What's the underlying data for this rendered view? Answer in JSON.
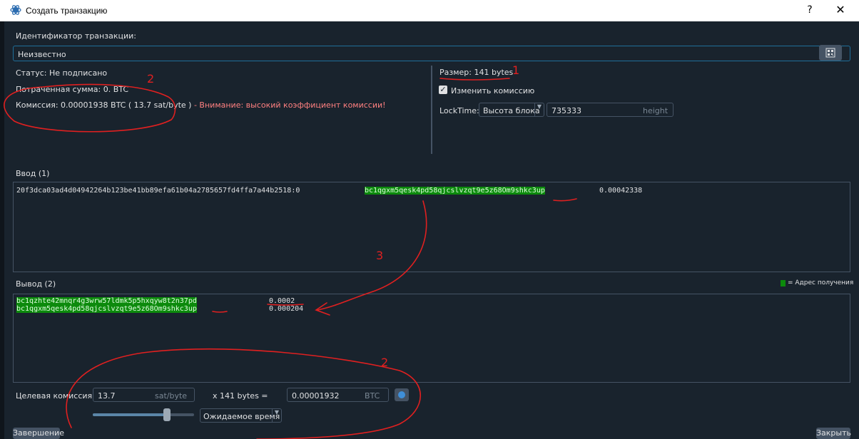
{
  "window": {
    "title": "Создать транзакцию",
    "help": "?",
    "close": "✕"
  },
  "txid": {
    "label": "Идентификатор транзакции:",
    "value": "Неизвестно"
  },
  "status": {
    "status_text": "Статус: Не подписано",
    "spent_text": "Потраченная сумма: 0. BTC",
    "fee_text": "Комиссия: 0.00001938 BTC ( 13.7 sat/byte )",
    "fee_warning": " - Внимание: высокий коэффициент комиссии!"
  },
  "right": {
    "size_text": "Размер: 141 bytes",
    "change_fee_label": "Изменить комиссию",
    "change_fee_checked": true,
    "locktime_label": "LockTime:",
    "locktime_mode": "Высота блока",
    "locktime_value": "735333",
    "locktime_unit": "height"
  },
  "inputs": {
    "label": "Ввод (1)",
    "rows": [
      {
        "txref": "20f3dca03ad4d04942264b123be41bb89efa61b04a2785657fd4ffa7a44b2518:0",
        "address": "bc1qgxm5qesk4pd58qjcslvzqt9e5z68Om9shkc3up",
        "amount": "0.00042338"
      }
    ]
  },
  "outputs": {
    "label": "Вывод (2)",
    "legend": "= Адрес получения",
    "rows": [
      {
        "address": "bc1qzhte42mnqr4g3wrw57ldmk5p5hxqyw8t2n37pd",
        "amount": "0.0002"
      },
      {
        "address": "bc1qgxm5qesk4pd58qjcslvzqt9e5z68Om9shkc3up",
        "amount": "0.000204"
      }
    ]
  },
  "fee_target": {
    "label": "Целевая комиссия:",
    "rate_value": "13.7",
    "rate_unit": "sat/byte",
    "times_size": "x  141 bytes  =",
    "fee_value": "0.00001932",
    "fee_unit": "BTC",
    "time_mode": "Ожидаемое время",
    "slider_fraction": 0.73
  },
  "buttons": {
    "finalize": "Завершение",
    "close": "Закрыть"
  },
  "annotations": {
    "n1": "1",
    "n2a": "2",
    "n3": "3",
    "n2b": "2"
  },
  "colors": {
    "background": "#19232d",
    "border": "#455364",
    "highlight": "#0c8a0c",
    "warning": "#ff8080",
    "annotation": "#e02020"
  }
}
